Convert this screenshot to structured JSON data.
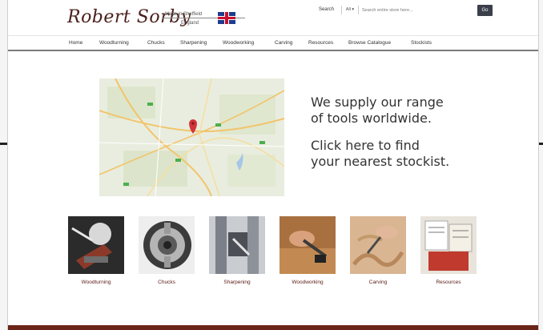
{
  "header": {
    "logo_text": "Robert Sorby",
    "logo_tagline_1": "Made in Sheffield",
    "logo_tagline_2": "England",
    "search_label": "Search",
    "search_scope": "All",
    "search_placeholder": "Search entire store here...",
    "search_button": "Go"
  },
  "nav": {
    "items": [
      {
        "label": "Home"
      },
      {
        "label": "Woodturning"
      },
      {
        "label": "Chucks"
      },
      {
        "label": "Sharpening"
      },
      {
        "label": "Woodworking"
      },
      {
        "label": "Carving"
      },
      {
        "label": "Resources"
      },
      {
        "label": "Browse Catalogue"
      },
      {
        "label": "Stockists"
      }
    ]
  },
  "banner": {
    "line1": "We supply our range\nof tools worldwide.",
    "line2": "Click here to find\nyour nearest stockist."
  },
  "categories": [
    {
      "label": "Woodturning",
      "icon": "woodturning-thumbnail"
    },
    {
      "label": "Chucks",
      "icon": "chuck-thumbnail"
    },
    {
      "label": "Sharpening",
      "icon": "sharpening-thumbnail"
    },
    {
      "label": "Woodworking",
      "icon": "woodworking-thumbnail"
    },
    {
      "label": "Carving",
      "icon": "carving-thumbnail"
    },
    {
      "label": "Resources",
      "icon": "resources-thumbnail"
    }
  ],
  "colors": {
    "brand": "#4a1f1a",
    "footer": "#6b2418",
    "map_pin": "#d2343a"
  }
}
